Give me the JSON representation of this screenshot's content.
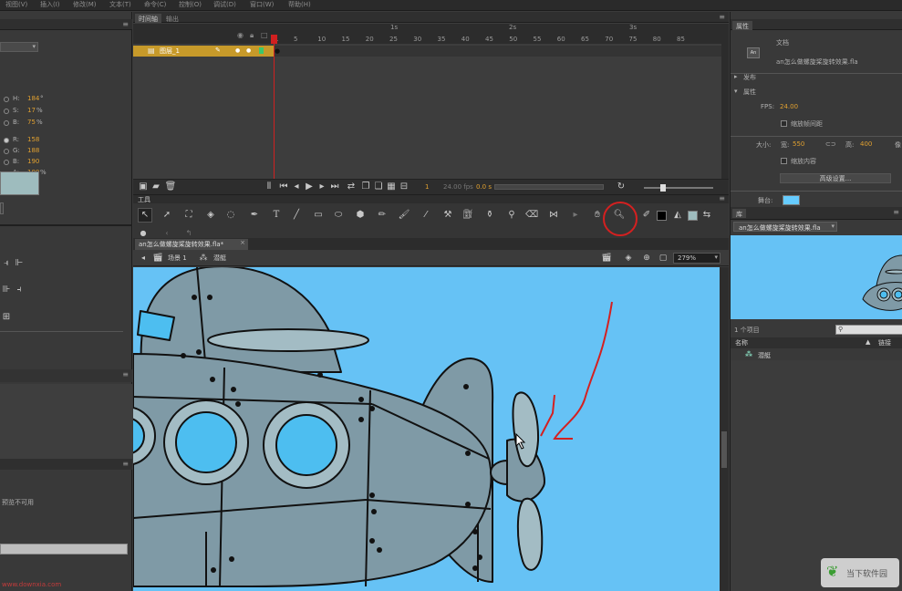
{
  "menubar": [
    "视图(V)",
    "插入(I)",
    "修改(M)",
    "文本(T)",
    "命令(C)",
    "控制(O)",
    "调试(D)",
    "窗口(W)",
    "帮助(H)"
  ],
  "color_panel": {
    "h_label": "H:",
    "h_value": "184",
    "h_unit": "°",
    "s_label": "S:",
    "s_value": "17",
    "s_unit": "%",
    "b_label": "B:",
    "b_value": "75",
    "b_unit": "%",
    "r_label": "R:",
    "r_value": "158",
    "g_label": "G:",
    "g_value": "188",
    "bl_label": "B:",
    "bl_value": "190",
    "a_label": "A:",
    "a_value": "100",
    "a_unit": "%",
    "swatch_color": "#9ebcbe"
  },
  "library_left": {
    "preview_text": "预览不可用"
  },
  "timeline": {
    "tabs": [
      "时间轴",
      "输出"
    ],
    "seconds": [
      "1s",
      "2s",
      "3s"
    ],
    "frame_numbers": [
      "1",
      "5",
      "10",
      "15",
      "20",
      "25",
      "30",
      "35",
      "40",
      "45",
      "50",
      "55",
      "60",
      "65",
      "70",
      "75",
      "80",
      "85"
    ],
    "layer_name": "图层_1",
    "current_frame": "1",
    "fps_readout": "24.00 fps",
    "time_readout": "0.0 s"
  },
  "tools_panel": {
    "title": "工具"
  },
  "document": {
    "tab_label": "an怎么做螺旋桨旋转效果.fla*",
    "scene_label": "场景 1",
    "symbol_label": "潜艇",
    "zoom": "279%"
  },
  "properties": {
    "tab": "属性",
    "doc_type": "文档",
    "doc_name": "an怎么做螺旋桨旋转效果.fla",
    "publish_section": "发布",
    "props_section": "属性",
    "fps_label": "FPS:",
    "fps_value": "24.00",
    "scale_spans_label": "缩放帧间距",
    "size_label": "大小:",
    "width_label": "宽:",
    "width_value": "550",
    "height_label": "高:",
    "height_value": "400",
    "scale_content_label": "缩放内容",
    "advanced_button": "高级设置...",
    "stage_label": "舞台:",
    "stage_color": "#66ccff"
  },
  "library": {
    "tab": "库",
    "doc_dropdown": "an怎么做螺旋桨旋转效果.fla",
    "item_count": "1 个项目",
    "col_name": "名称",
    "col_link": "链接",
    "items": [
      "潜艇"
    ]
  },
  "colors": {
    "stage_bg": "#66c2f5",
    "sub_body": "#7f9aa6",
    "window_fill": "#4dbef0",
    "frame_ring": "#a3bcc4",
    "annotation_red": "#d42020",
    "playhead": "#d02020",
    "layer_highlight": "#c79a2a"
  },
  "watermark": {
    "text": "当下软件园"
  }
}
